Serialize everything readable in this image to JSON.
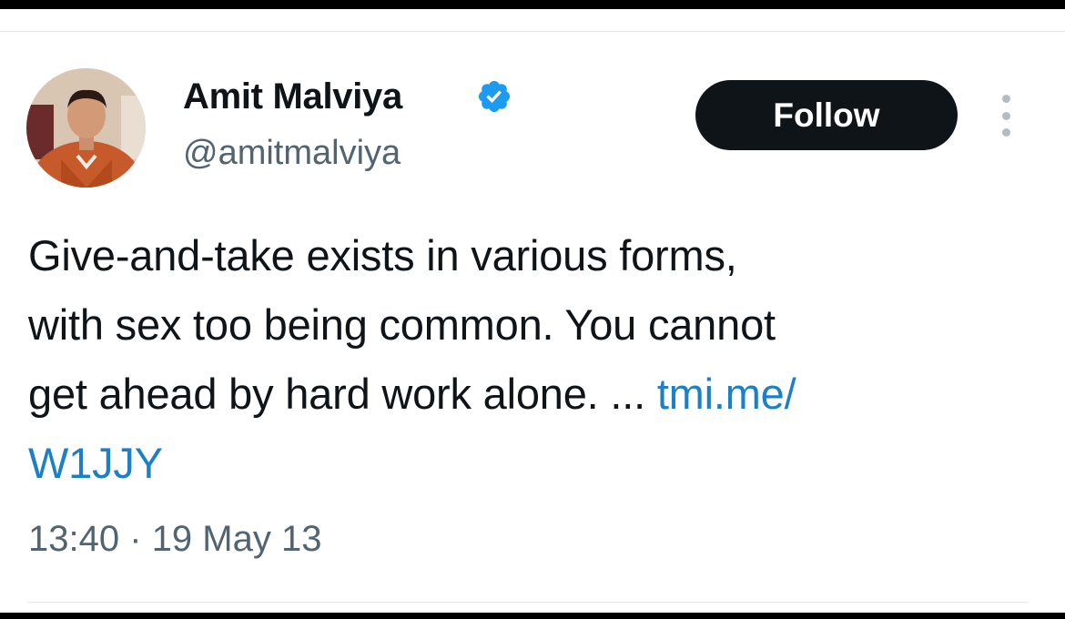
{
  "tweet": {
    "author": {
      "display_name": "Amit Malviya",
      "handle": "@amitmalviya",
      "verified": true,
      "avatar_icon": "profile-photo"
    },
    "follow_label": "Follow",
    "more_icon": "more-options-icon",
    "text": {
      "line1": "Give-and-take exists in various forms,",
      "line2": "with sex too being common. You cannot",
      "line3_prefix": "get ahead by hard work alone. ... ",
      "link_part1": "tmi.me/",
      "link_part2": "W1JJY"
    },
    "time": "13:40",
    "separator": "·",
    "date": "19 May 13"
  },
  "colors": {
    "link": "#1d7fc4",
    "verified_badge": "#1d9bf0",
    "follow_bg": "#0f1419",
    "secondary_text": "#536471"
  }
}
